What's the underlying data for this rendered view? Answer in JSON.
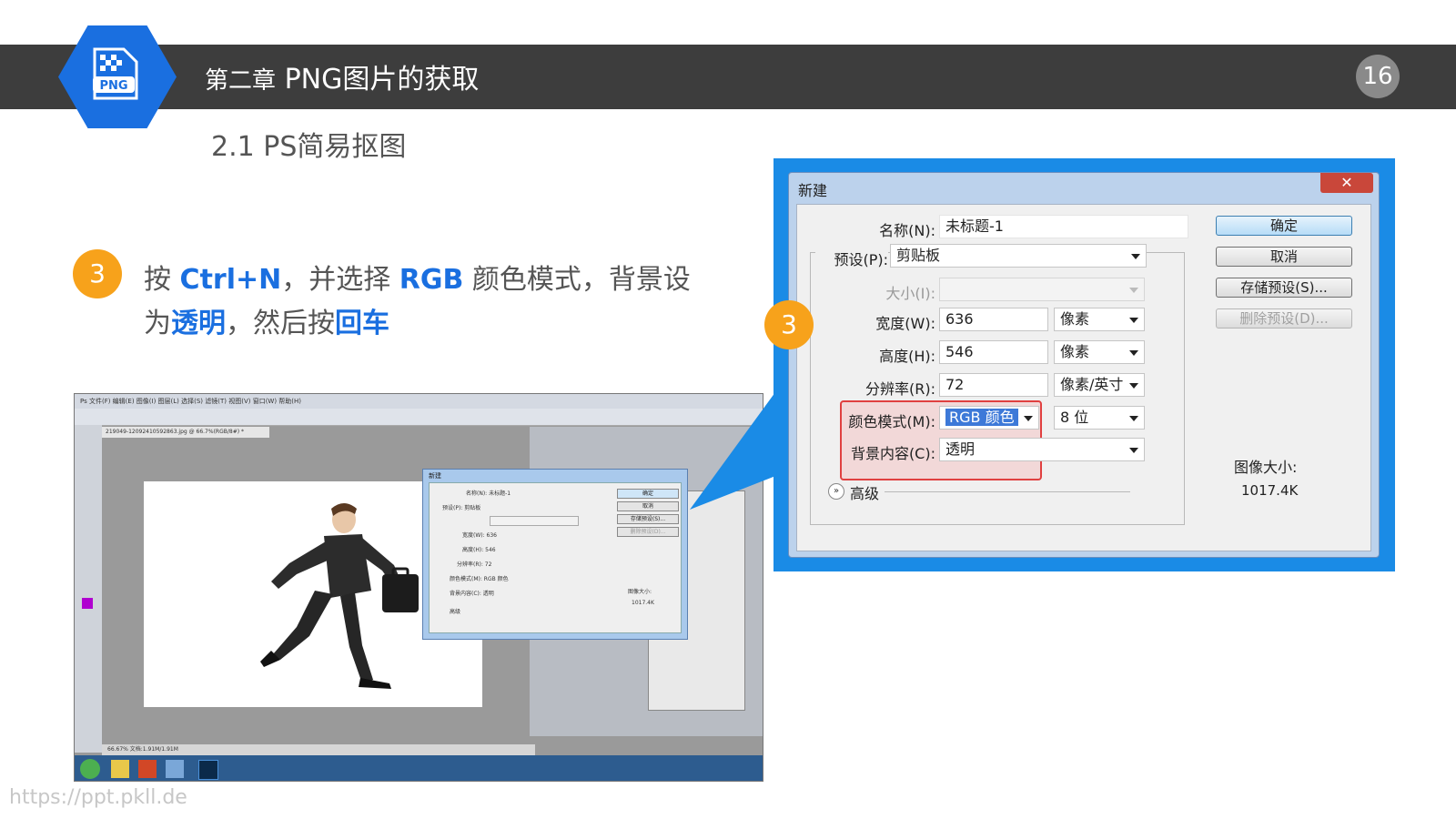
{
  "header": {
    "chapter_prefix": "第二章",
    "chapter_title": "PNG图片的获取",
    "page_number": "16",
    "logo_text": "PNG"
  },
  "subtitle": "2.1 PS简易抠图",
  "step": {
    "number": "3",
    "instruction": {
      "part1": "按 ",
      "hotkey": "Ctrl+N",
      "part2": "，并选择 ",
      "mode": "RGB",
      "part3": " 颜色模式，背景设为",
      "bg": "透明",
      "part4": "，然后按",
      "enter": "回车"
    }
  },
  "screenshot": {
    "menu": "Ps  文件(F)  编辑(E)  图像(I)  图层(L)  选择(S)  滤镜(T)  视图(V)  窗口(W)  帮助(H)",
    "doc_tab": "219049-12092410592863.jpg @ 66.7%(RGB/8#) *",
    "status": "66.67%    文档:1.91M/1.91M",
    "mini_dialog": {
      "title": "新建",
      "name": "名称(N):  未标题-1",
      "preset": "预设(P):  剪贴板",
      "width": "宽度(W):  636",
      "height": "高度(H):  546",
      "resolution": "分辨率(R):  72",
      "color_mode": "颜色模式(M):  RGB 颜色",
      "bg": "背景内容(C):  透明",
      "advanced": "高级",
      "ok": "确定",
      "cancel": "取消",
      "save": "存储预设(S)...",
      "delete": "删除预设(D)...",
      "size_label": "图像大小:",
      "size_value": "1017.4K"
    }
  },
  "dialog": {
    "title": "新建",
    "close": "✕",
    "fields": {
      "name_label": "名称(N):",
      "name_value": "未标题-1",
      "preset_label": "预设(P):",
      "preset_value": "剪贴板",
      "size_label": "大小(I):",
      "width_label": "宽度(W):",
      "width_value": "636",
      "width_unit": "像素",
      "height_label": "高度(H):",
      "height_value": "546",
      "height_unit": "像素",
      "resolution_label": "分辨率(R):",
      "resolution_value": "72",
      "resolution_unit": "像素/英寸",
      "color_mode_label": "颜色模式(M):",
      "color_mode_value": "RGB 颜色",
      "bit_depth": "8 位",
      "background_label": "背景内容(C):",
      "background_value": "透明",
      "advanced": "高级"
    },
    "buttons": {
      "ok": "确定",
      "cancel": "取消",
      "save_preset": "存储预设(S)...",
      "delete_preset": "删除预设(D)..."
    },
    "image_size_label": "图像大小:",
    "image_size_value": "1017.4K"
  },
  "watermark": "https://ppt.pkll.de",
  "colors": {
    "accent_blue": "#1a6fe0",
    "badge_orange": "#f7a21b",
    "header_dark": "#3d3d3d",
    "highlight_red": "#e04040"
  }
}
